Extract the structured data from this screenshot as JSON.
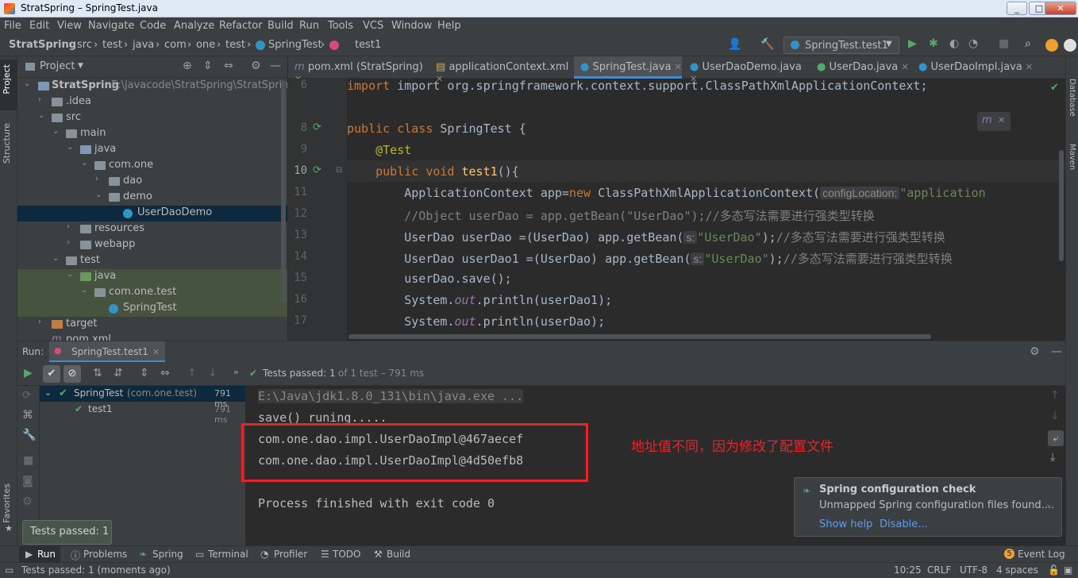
{
  "window": {
    "title": "StratSpring – SpringTest.java",
    "min": "_",
    "max": "□",
    "close": "✕"
  },
  "menu": [
    "File",
    "Edit",
    "View",
    "Navigate",
    "Code",
    "Analyze",
    "Refactor",
    "Build",
    "Run",
    "Tools",
    "VCS",
    "Window",
    "Help"
  ],
  "breadcrumb": [
    "StratSpring",
    "src",
    "test",
    "java",
    "com",
    "one",
    "test",
    "SpringTest",
    "test1"
  ],
  "run_config": "SpringTest.test1",
  "left_tabs": {
    "project": "Project",
    "structure": "Structure",
    "favorites": "Favorites"
  },
  "right_tabs": {
    "database": "Database",
    "maven": "Maven"
  },
  "project_panel": {
    "title": "Project",
    "tree": [
      {
        "label": "StratSpring",
        "path": "E:\\javacode\\StratSpring\\StratSpring"
      },
      {
        "label": ".idea"
      },
      {
        "label": "src"
      },
      {
        "label": "main"
      },
      {
        "label": "java"
      },
      {
        "label": "com.one"
      },
      {
        "label": "dao"
      },
      {
        "label": "demo"
      },
      {
        "label": "UserDaoDemo"
      },
      {
        "label": "resources"
      },
      {
        "label": "webapp"
      },
      {
        "label": "test"
      },
      {
        "label": "java"
      },
      {
        "label": "com.one.test"
      },
      {
        "label": "SpringTest"
      },
      {
        "label": "target"
      },
      {
        "label": "pom.xml"
      }
    ]
  },
  "editor_tabs": [
    "pom.xml (StratSpring)",
    "applicationContext.xml",
    "SpringTest.java",
    "UserDaoDemo.java",
    "UserDao.java",
    "UserDaoImpl.java"
  ],
  "line_numbers": [
    "6",
    "",
    "8",
    "9",
    "10",
    "11",
    "12",
    "13",
    "14",
    "15",
    "16",
    "17"
  ],
  "code": {
    "l6": "import org.springframework.context.support.ClassPathXmlApplicationContext;",
    "l8a": "public class ",
    "l8b": "SpringTest {",
    "l9": "@Test",
    "l10a": "public void ",
    "l10b": "test1",
    "l10c": "(){",
    "l11a": "ApplicationContext app=",
    "l11b": "new ",
    "l11c": "ClassPathXmlApplicationContext(",
    "l11hint": "configLocation:",
    "l11d": "\"application",
    "l12": "//Object userDao = app.getBean(\"UserDao\");//多态写法需要进行强类型转换",
    "l13a": "UserDao userDao =(UserDao) app.getBean(",
    "l13hint": "s:",
    "l13b": "\"UserDao\"",
    "l13c": ");",
    "l13d": "//多态写法需要进行强类型转换",
    "l14a": "UserDao userDao1 =(UserDao) app.getBean(",
    "l14hint": "s:",
    "l14b": "\"UserDao\"",
    "l14c": ");",
    "l14d": "//多态写法需要进行强类型转换",
    "l15": "userDao.save();",
    "l16a": "System.",
    "l16b": "out",
    "l16c": ".println(userDao1);",
    "l17a": "System.",
    "l17b": "out",
    "l17c": ".println(userDao);"
  },
  "run": {
    "label": "Run:",
    "tab": "SpringTest.test1",
    "status_passed": "Tests passed: 1",
    "status_detail": "of 1 test – 791 ms",
    "tree": [
      {
        "label": "SpringTest",
        "pkg": "(com.one.test)",
        "time": "791 ms"
      },
      {
        "label": "test1",
        "time": "791 ms"
      }
    ],
    "console": [
      "E:\\Java\\jdk1.8.0_131\\bin\\java.exe ...",
      "save() runing.....",
      "com.one.dao.impl.UserDaoImpl@467aecef",
      "com.one.dao.impl.UserDaoImpl@4d50efb8",
      "",
      "Process finished with exit code 0"
    ]
  },
  "annotation": "地址值不同，因为修改了配置文件",
  "notification": {
    "title": "Spring configuration check",
    "body": "Unmapped Spring configuration files found....",
    "link1": "Show help",
    "link2": "Disable..."
  },
  "tooltip": "Tests passed: 1",
  "bottom_tabs": [
    "Run",
    "Problems",
    "Spring",
    "Terminal",
    "Profiler",
    "TODO",
    "Build"
  ],
  "event_log": "Event Log",
  "event_count": "5",
  "status": {
    "message": "Tests passed: 1 (moments ago)",
    "position": "10:25",
    "line_sep": "CRLF",
    "encoding": "UTF-8",
    "indent": "4 spaces"
  }
}
